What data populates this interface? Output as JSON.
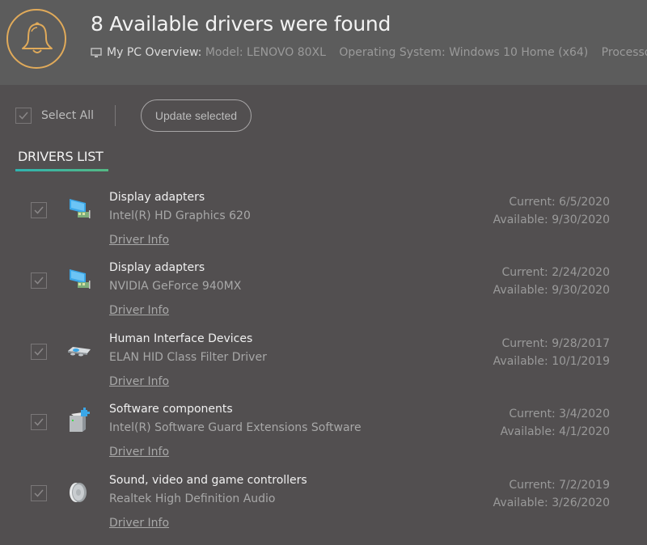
{
  "header": {
    "title": "8 Available drivers were found",
    "overview_label": "My PC Overview:",
    "model": "Model: LENOVO 80XL",
    "os": "Operating System: Windows 10 Home (x64)",
    "processor": "Processor: Int",
    "accent_color": "#e0aa5a"
  },
  "toolbar": {
    "select_all_label": "Select All",
    "select_all_checked": true,
    "update_label": "Update selected"
  },
  "tab": {
    "label": "DRIVERS LIST"
  },
  "drivers": [
    {
      "category": "Display adapters",
      "device": "Intel(R) HD Graphics 620",
      "info_label": "Driver Info",
      "current": "Current:  6/5/2020",
      "available": "Available:  9/30/2020",
      "icon": "display-adapter-icon",
      "checked": true
    },
    {
      "category": "Display adapters",
      "device": "NVIDIA GeForce 940MX",
      "info_label": "Driver Info",
      "current": "Current:  2/24/2020",
      "available": "Available:  9/30/2020",
      "icon": "display-adapter-icon",
      "checked": true
    },
    {
      "category": "Human Interface Devices",
      "device": "ELAN HID Class Filter Driver",
      "info_label": "Driver Info",
      "current": "Current:  9/28/2017",
      "available": "Available:  10/1/2019",
      "icon": "hid-icon",
      "checked": true
    },
    {
      "category": "Software components",
      "device": "Intel(R) Software Guard Extensions Software",
      "info_label": "Driver Info",
      "current": "Current:  3/4/2020",
      "available": "Available:  4/1/2020",
      "icon": "software-component-icon",
      "checked": true
    },
    {
      "category": "Sound, video and game controllers",
      "device": "Realtek High Definition Audio",
      "info_label": "Driver Info",
      "current": "Current:  7/2/2019",
      "available": "Available:  3/26/2020",
      "icon": "speaker-icon",
      "checked": true
    }
  ]
}
